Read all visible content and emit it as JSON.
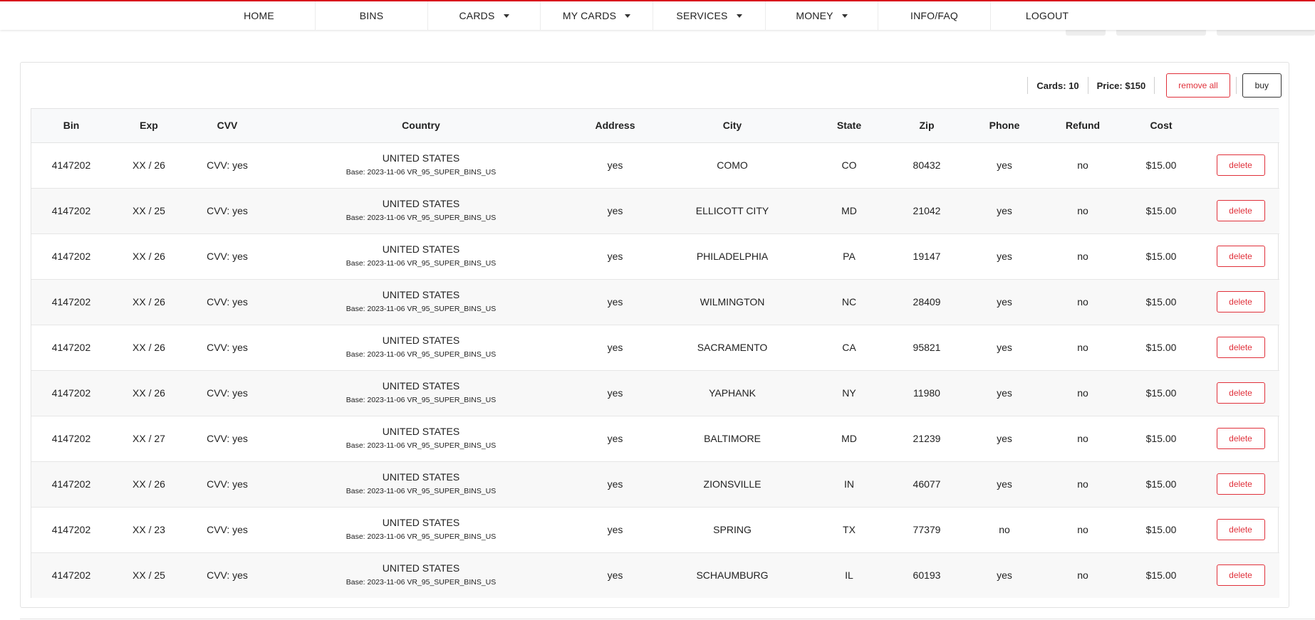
{
  "nav": {
    "items": [
      {
        "label": "HOME",
        "dropdown": false
      },
      {
        "label": "BINS",
        "dropdown": false
      },
      {
        "label": "CARDS",
        "dropdown": true
      },
      {
        "label": "MY CARDS",
        "dropdown": true
      },
      {
        "label": "SERVICES",
        "dropdown": true
      },
      {
        "label": "MONEY",
        "dropdown": true
      },
      {
        "label": "INFO/FAQ",
        "dropdown": false
      },
      {
        "label": "LOGOUT",
        "dropdown": false
      }
    ]
  },
  "cart": {
    "cards_text": "Cards: 10",
    "price_text": "Price: $150",
    "remove_all_label": "remove all",
    "buy_label": "buy"
  },
  "table": {
    "headers": [
      "Bin",
      "Exp",
      "CVV",
      "Country",
      "Address",
      "City",
      "State",
      "Zip",
      "Phone",
      "Refund",
      "Cost",
      ""
    ],
    "delete_label": "delete",
    "rows": [
      {
        "bin": "4147202",
        "exp": "XX / 26",
        "cvv": "CVV: yes",
        "country": "UNITED STATES",
        "base": "Base: 2023-11-06 VR_95_SUPER_BINS_US",
        "address": "yes",
        "city": "COMO",
        "state": "CO",
        "zip": "80432",
        "phone": "yes",
        "refund": "no",
        "cost": "$15.00"
      },
      {
        "bin": "4147202",
        "exp": "XX / 25",
        "cvv": "CVV: yes",
        "country": "UNITED STATES",
        "base": "Base: 2023-11-06 VR_95_SUPER_BINS_US",
        "address": "yes",
        "city": "ELLICOTT CITY",
        "state": "MD",
        "zip": "21042",
        "phone": "yes",
        "refund": "no",
        "cost": "$15.00"
      },
      {
        "bin": "4147202",
        "exp": "XX / 26",
        "cvv": "CVV: yes",
        "country": "UNITED STATES",
        "base": "Base: 2023-11-06 VR_95_SUPER_BINS_US",
        "address": "yes",
        "city": "PHILADELPHIA",
        "state": "PA",
        "zip": "19147",
        "phone": "yes",
        "refund": "no",
        "cost": "$15.00"
      },
      {
        "bin": "4147202",
        "exp": "XX / 26",
        "cvv": "CVV: yes",
        "country": "UNITED STATES",
        "base": "Base: 2023-11-06 VR_95_SUPER_BINS_US",
        "address": "yes",
        "city": "WILMINGTON",
        "state": "NC",
        "zip": "28409",
        "phone": "yes",
        "refund": "no",
        "cost": "$15.00"
      },
      {
        "bin": "4147202",
        "exp": "XX / 26",
        "cvv": "CVV: yes",
        "country": "UNITED STATES",
        "base": "Base: 2023-11-06 VR_95_SUPER_BINS_US",
        "address": "yes",
        "city": "SACRAMENTO",
        "state": "CA",
        "zip": "95821",
        "phone": "yes",
        "refund": "no",
        "cost": "$15.00"
      },
      {
        "bin": "4147202",
        "exp": "XX / 26",
        "cvv": "CVV: yes",
        "country": "UNITED STATES",
        "base": "Base: 2023-11-06 VR_95_SUPER_BINS_US",
        "address": "yes",
        "city": "YAPHANK",
        "state": "NY",
        "zip": "11980",
        "phone": "yes",
        "refund": "no",
        "cost": "$15.00"
      },
      {
        "bin": "4147202",
        "exp": "XX / 27",
        "cvv": "CVV: yes",
        "country": "UNITED STATES",
        "base": "Base: 2023-11-06 VR_95_SUPER_BINS_US",
        "address": "yes",
        "city": "BALTIMORE",
        "state": "MD",
        "zip": "21239",
        "phone": "yes",
        "refund": "no",
        "cost": "$15.00"
      },
      {
        "bin": "4147202",
        "exp": "XX / 26",
        "cvv": "CVV: yes",
        "country": "UNITED STATES",
        "base": "Base: 2023-11-06 VR_95_SUPER_BINS_US",
        "address": "yes",
        "city": "ZIONSVILLE",
        "state": "IN",
        "zip": "46077",
        "phone": "yes",
        "refund": "no",
        "cost": "$15.00"
      },
      {
        "bin": "4147202",
        "exp": "XX / 23",
        "cvv": "CVV: yes",
        "country": "UNITED STATES",
        "base": "Base: 2023-11-06 VR_95_SUPER_BINS_US",
        "address": "yes",
        "city": "SPRING",
        "state": "TX",
        "zip": "77379",
        "phone": "no",
        "refund": "no",
        "cost": "$15.00"
      },
      {
        "bin": "4147202",
        "exp": "XX / 25",
        "cvv": "CVV: yes",
        "country": "UNITED STATES",
        "base": "Base: 2023-11-06 VR_95_SUPER_BINS_US",
        "address": "yes",
        "city": "SCHAUMBURG",
        "state": "IL",
        "zip": "60193",
        "phone": "yes",
        "refund": "no",
        "cost": "$15.00"
      }
    ]
  },
  "colors": {
    "accent_red": "#e0303a",
    "top_border": "#d9111c"
  }
}
